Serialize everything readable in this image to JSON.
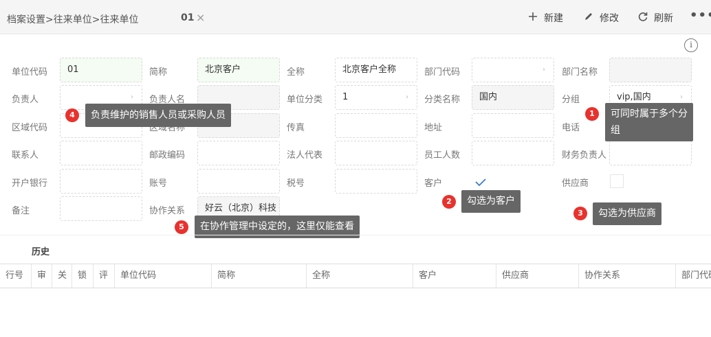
{
  "header": {
    "breadcrumb": "档案设置>往来单位>往来单位",
    "tab_label": "01",
    "tab_close": "×",
    "new_label": "新建",
    "edit_label": "修改",
    "refresh_label": "刷新",
    "more": "•••"
  },
  "form": {
    "code_label": "单位代码",
    "code_value": "01",
    "short_label": "简称",
    "short_value": "北京客户",
    "full_label": "全称",
    "full_value": "北京客户全称",
    "dept_code_label": "部门代码",
    "dept_name_label": "部门名称",
    "owner_label": "负责人",
    "owner_name_label": "负责人名",
    "category_label": "单位分类",
    "category_value": "1",
    "category_name_label": "分类名称",
    "category_name_value": "国内",
    "group_label": "分组",
    "group_value": "vip,国内",
    "region_code_label": "区域代码",
    "region_name_label": "区域名称",
    "fax_label": "传真",
    "address_label": "地址",
    "phone_label": "电话",
    "contact_label": "联系人",
    "zip_label": "邮政编码",
    "legal_label": "法人代表",
    "staff_label": "员工人数",
    "finance_label": "财务负责人",
    "bank_label": "开户银行",
    "account_label": "账号",
    "tax_label": "税号",
    "customer_label": "客户",
    "supplier_label": "供应商",
    "remark_label": "备注",
    "collab_label": "协作关系",
    "collab_value": "好云（北京）科技"
  },
  "tips": {
    "t1_num": "1",
    "t1_line1": "可同时属于多个分",
    "t1_line2": "组",
    "t2_num": "2",
    "t2_text": "勾选为客户",
    "t3_num": "3",
    "t3_text": "勾选为供应商",
    "t4_num": "4",
    "t4_text": "负责维护的销售人员或采购人员",
    "t5_num": "5",
    "t5_text": "在协作管理中设定的，这里仅能查看"
  },
  "history": {
    "title": "历史",
    "columns": [
      "行号",
      "审",
      "关",
      "锁",
      "评",
      "单位代码",
      "简称",
      "全称",
      "客户",
      "供应商",
      "协作关系",
      "部门代码"
    ]
  },
  "customer_checked": true,
  "supplier_checked": false
}
